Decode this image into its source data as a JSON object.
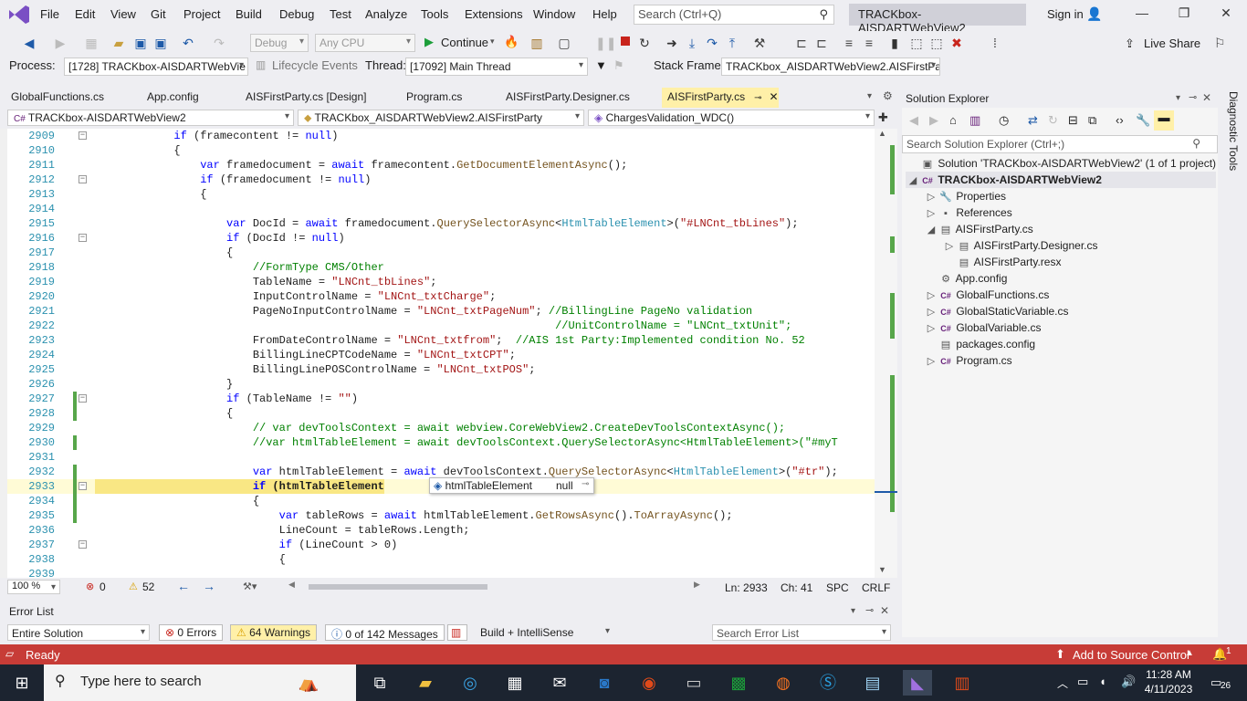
{
  "menu": {
    "items": [
      "File",
      "Edit",
      "View",
      "Git",
      "Project",
      "Build",
      "Debug",
      "Test",
      "Analyze",
      "Tools",
      "Extensions",
      "Window",
      "Help"
    ],
    "search_placeholder": "Search (Ctrl+Q)",
    "solution_title": "TRACKbox-AISDARTWebView2",
    "signin": "Sign in"
  },
  "toolbar": {
    "config": "Debug",
    "platform": "Any CPU",
    "continue_label": "Continue",
    "live_share": "Live Share"
  },
  "debugbar": {
    "process_label": "Process:",
    "process_value": "[1728] TRACKbox-AISDARTWebVie",
    "lifecycle": "Lifecycle Events",
    "thread_label": "Thread:",
    "thread_value": "[17092] Main Thread",
    "stackframe_label": "Stack Frame:",
    "stackframe_value": "TRACKbox_AISDARTWebView2.AISFirstPar"
  },
  "tabs": [
    "GlobalFunctions.cs",
    "App.config",
    "AISFirstParty.cs [Design]",
    "Program.cs",
    "AISFirstParty.Designer.cs",
    "AISFirstParty.cs"
  ],
  "navbar": {
    "project": "TRACKbox-AISDARTWebView2",
    "class": "TRACKbox_AISDARTWebView2.AISFirstParty",
    "method": "ChargesValidation_WDC()"
  },
  "code_lines": [
    {
      "n": "2909",
      "t": "            if (framecontent != null)"
    },
    {
      "n": "2910",
      "t": "            {"
    },
    {
      "n": "2911",
      "t": "                var framedocument = await framecontent.GetDocumentElementAsync();"
    },
    {
      "n": "2912",
      "t": "                if (framedocument != null)"
    },
    {
      "n": "2913",
      "t": "                {"
    },
    {
      "n": "2914",
      "t": ""
    },
    {
      "n": "2915",
      "t": "                    var DocId = await framedocument.QuerySelectorAsync<HtmlTableElement>(\"#LNCnt_tbLines\");"
    },
    {
      "n": "2916",
      "t": "                    if (DocId != null)"
    },
    {
      "n": "2917",
      "t": "                    {"
    },
    {
      "n": "2918",
      "t": "                        //FormType CMS/Other"
    },
    {
      "n": "2919",
      "t": "                        TableName = \"LNCnt_tbLines\";"
    },
    {
      "n": "2920",
      "t": "                        InputControlName = \"LNCnt_txtCharge\";"
    },
    {
      "n": "2921",
      "t": "                        PageNoInputControlName = \"LNCnt_txtPageNum\"; //BillingLine PageNo validation"
    },
    {
      "n": "2922",
      "t": "                                                                      //UnitControlName = \"LNCnt_txtUnit\";"
    },
    {
      "n": "2923",
      "t": "                        FromDateControlName = \"LNCnt_txtfrom\";  //AIS 1st Party:Implemented condition No. 52"
    },
    {
      "n": "2924",
      "t": "                        BillingLineCPTCodeName = \"LNCnt_txtCPT\";"
    },
    {
      "n": "2925",
      "t": "                        BillingLinePOSControlName = \"LNCnt_txtPOS\";"
    },
    {
      "n": "2926",
      "t": "                    }"
    },
    {
      "n": "2927",
      "t": "                    if (TableName != \"\")"
    },
    {
      "n": "2928",
      "t": "                    {"
    },
    {
      "n": "2929",
      "t": "                        // var devToolsContext = await webview.CoreWebView2.CreateDevToolsContextAsync();"
    },
    {
      "n": "2930",
      "t": "                        //var htmlTableElement = await devToolsContext.QuerySelectorAsync<HtmlTableElement>(\"#myT"
    },
    {
      "n": "2931",
      "t": ""
    },
    {
      "n": "2932",
      "t": "                        var htmlTableElement = await devToolsContext.QuerySelectorAsync<HtmlTableElement>(\"#tr\");"
    },
    {
      "n": "2933",
      "t": "                        if (htmlTableElement"
    },
    {
      "n": "2934",
      "t": "                        {"
    },
    {
      "n": "2935",
      "t": "                            var tableRows = await htmlTableElement.GetRowsAsync().ToArrayAsync();"
    },
    {
      "n": "2936",
      "t": "                            LineCount = tableRows.Length;"
    },
    {
      "n": "2937",
      "t": "                            if (LineCount > 0)"
    },
    {
      "n": "2938",
      "t": "                            {"
    },
    {
      "n": "2939",
      "t": ""
    }
  ],
  "datatip": {
    "name": "htmlTableElement",
    "value": "null"
  },
  "editor_status": {
    "zoom": "100 %",
    "errors": "0",
    "warnings": "52",
    "ln": "Ln: 2933",
    "ch": "Ch: 41",
    "spc": "SPC",
    "crlf": "CRLF"
  },
  "error_list": {
    "title": "Error List",
    "scope": "Entire Solution",
    "errors": "0 Errors",
    "warnings": "64 Warnings",
    "messages": "0 of 142 Messages",
    "build": "Build + IntelliSense",
    "search_placeholder": "Search Error List"
  },
  "solution_explorer": {
    "title": "Solution Explorer",
    "search_placeholder": "Search Solution Explorer (Ctrl+;)",
    "items": [
      {
        "label": "Solution 'TRACKbox-AISDARTWebView2' (1 of 1 project)",
        "level": 0,
        "arrow": "",
        "icon": "▣"
      },
      {
        "label": "TRACKbox-AISDARTWebView2",
        "level": 0,
        "arrow": "◢",
        "icon": "C#"
      },
      {
        "label": "Properties",
        "level": 1,
        "arrow": "▷",
        "icon": "🔧"
      },
      {
        "label": "References",
        "level": 1,
        "arrow": "▷",
        "icon": "▪"
      },
      {
        "label": "AISFirstParty.cs",
        "level": 1,
        "arrow": "◢",
        "icon": "▤"
      },
      {
        "label": "AISFirstParty.Designer.cs",
        "level": 2,
        "arrow": "▷",
        "icon": "▤"
      },
      {
        "label": "AISFirstParty.resx",
        "level": 2,
        "arrow": "",
        "icon": "▤"
      },
      {
        "label": "App.config",
        "level": 1,
        "arrow": "",
        "icon": "⚙"
      },
      {
        "label": "GlobalFunctions.cs",
        "level": 1,
        "arrow": "▷",
        "icon": "C#"
      },
      {
        "label": "GlobalStaticVariable.cs",
        "level": 1,
        "arrow": "▷",
        "icon": "C#"
      },
      {
        "label": "GlobalVariable.cs",
        "level": 1,
        "arrow": "▷",
        "icon": "C#"
      },
      {
        "label": "packages.config",
        "level": 1,
        "arrow": "",
        "icon": "▤"
      },
      {
        "label": "Program.cs",
        "level": 1,
        "arrow": "▷",
        "icon": "C#"
      }
    ]
  },
  "diagnostic_tools": "Diagnostic Tools",
  "statusbar": {
    "state": "Ready",
    "source_control": "Add to Source Control",
    "notif": "1"
  },
  "taskbar": {
    "search_placeholder": "Type here to search",
    "time": "11:28 AM",
    "date": "4/11/2023",
    "badge": "26"
  }
}
